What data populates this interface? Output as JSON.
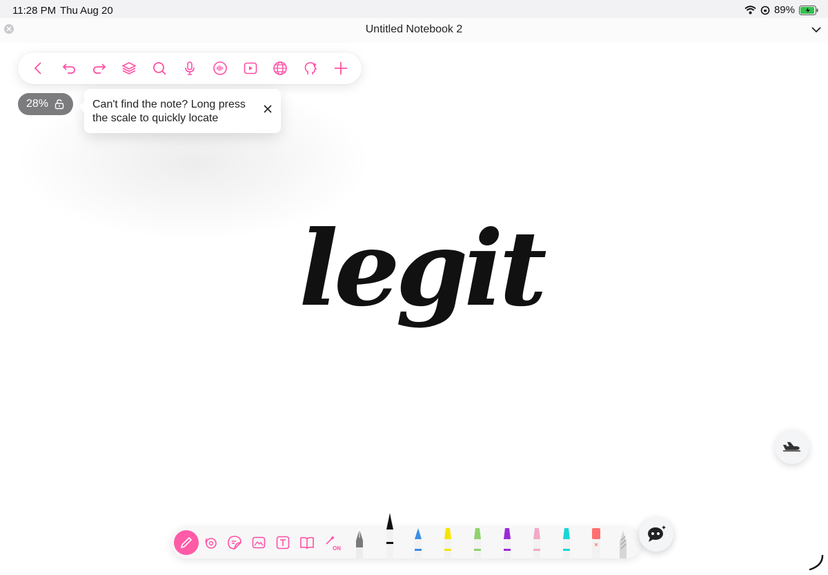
{
  "status": {
    "time": "11:28 PM",
    "date": "Thu Aug 20",
    "battery": "89%"
  },
  "window": {
    "title": "Untitled Notebook 2"
  },
  "toolbar": {
    "icons": [
      "back-icon",
      "undo-icon",
      "redo-icon",
      "layers-icon",
      "search-icon",
      "microphone-icon",
      "audio-wave-icon",
      "video-icon",
      "globe-icon",
      "assistant-head-icon",
      "add-icon"
    ],
    "accent": "#ff4fa3"
  },
  "zoom": {
    "label": "28%"
  },
  "tip": {
    "text": "Can't find the note? Long press the scale to quickly locate"
  },
  "canvas": {
    "word": "legit"
  },
  "bottom_tools": {
    "icons": [
      "pen-icon",
      "lasso-icon",
      "sticker-icon",
      "image-icon",
      "text-icon",
      "book-icon",
      "magic-wand-icon"
    ],
    "magic_label": "ON",
    "pen_colors": [
      "#888888",
      "#111111",
      "#3a8ee6",
      "#f5e400",
      "#8fd36a",
      "#9b2ad8",
      "#f2a9c6",
      "#19d6d6",
      "#ff6f6f"
    ]
  }
}
